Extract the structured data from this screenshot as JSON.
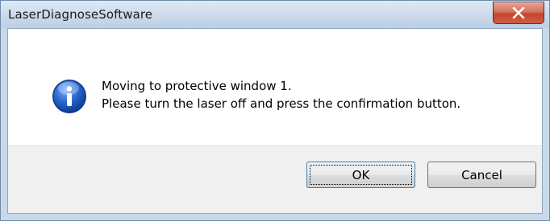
{
  "window": {
    "title": "LaserDiagnoseSoftware",
    "close_icon": "close-x-icon"
  },
  "dialog": {
    "icon": "info-icon",
    "message_lines": [
      "Moving to protective window 1.",
      "Please turn the laser off and press the confirmation button."
    ]
  },
  "buttons": {
    "ok_label": "OK",
    "cancel_label": "Cancel"
  },
  "colors": {
    "close_button": "#c94b33",
    "info_icon": "#1a56b8"
  }
}
